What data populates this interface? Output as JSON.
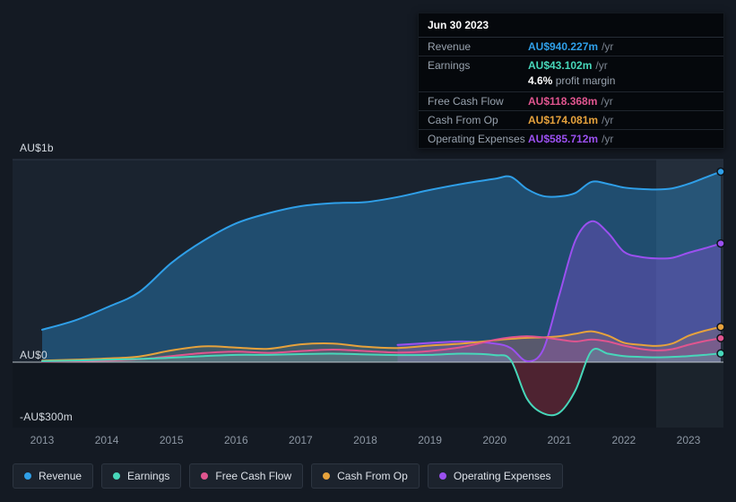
{
  "tooltip": {
    "date": "Jun 30 2023",
    "rows": [
      {
        "label": "Revenue",
        "value": "AU$940.227m",
        "suffix": "/yr",
        "color": "#2f9fe8"
      },
      {
        "label": "Earnings",
        "value": "AU$43.102m",
        "suffix": "/yr",
        "color": "#47d7ba",
        "sub_value": "4.6%",
        "sub_label": "profit margin"
      },
      {
        "label": "Free Cash Flow",
        "value": "AU$118.368m",
        "suffix": "/yr",
        "color": "#e0558f"
      },
      {
        "label": "Cash From Op",
        "value": "AU$174.081m",
        "suffix": "/yr",
        "color": "#e6a23c"
      },
      {
        "label": "Operating Expenses",
        "value": "AU$585.712m",
        "suffix": "/yr",
        "color": "#9b50f0"
      }
    ]
  },
  "axis": {
    "y_labels": [
      {
        "text": "AU$1b"
      },
      {
        "text": "AU$0"
      },
      {
        "text": "-AU$300m"
      }
    ],
    "x_ticks": [
      "2013",
      "2014",
      "2015",
      "2016",
      "2017",
      "2018",
      "2019",
      "2020",
      "2021",
      "2022",
      "2023"
    ]
  },
  "legend": [
    {
      "label": "Revenue",
      "color": "#2f9fe8"
    },
    {
      "label": "Earnings",
      "color": "#47d7ba"
    },
    {
      "label": "Free Cash Flow",
      "color": "#e0558f"
    },
    {
      "label": "Cash From Op",
      "color": "#e6a23c"
    },
    {
      "label": "Operating Expenses",
      "color": "#9b50f0"
    }
  ],
  "chart_data": {
    "type": "area",
    "unit": "AU$ millions per year",
    "x_range": [
      2013,
      2023.5
    ],
    "highlight_x": [
      2022.5,
      2023.55
    ],
    "y_ticks": [
      {
        "value": 1000,
        "label": "AU$1b"
      },
      {
        "value": 0,
        "label": "AU$0"
      },
      {
        "value": -300,
        "label": "-AU$300m"
      }
    ],
    "gridlines": [
      1000,
      0
    ],
    "ylim": [
      -330,
      1080
    ],
    "x": [
      2013,
      2013.5,
      2014,
      2014.5,
      2015,
      2015.5,
      2016,
      2016.5,
      2017,
      2017.5,
      2018,
      2018.5,
      2019,
      2019.5,
      2020,
      2020.25,
      2020.5,
      2020.75,
      2021,
      2021.25,
      2021.5,
      2021.75,
      2022,
      2022.25,
      2022.5,
      2022.75,
      2023,
      2023.25,
      2023.5
    ],
    "series": [
      {
        "name": "Revenue",
        "color": "#2f9fe8",
        "fill_opacity": 0.35,
        "values": [
          160,
          205,
          270,
          345,
          490,
          600,
          685,
          735,
          770,
          785,
          790,
          815,
          850,
          880,
          905,
          915,
          855,
          820,
          818,
          835,
          890,
          880,
          862,
          855,
          852,
          858,
          880,
          910,
          940.227
        ]
      },
      {
        "name": "Earnings",
        "color": "#47d7ba",
        "fill_opacity": 0.2,
        "negative_fill": "#8b3043",
        "values": [
          5,
          8,
          12,
          16,
          22,
          30,
          36,
          36,
          40,
          42,
          38,
          35,
          36,
          42,
          35,
          10,
          -180,
          -252,
          -250,
          -140,
          55,
          42,
          30,
          26,
          24,
          26,
          30,
          36,
          43.102
        ]
      },
      {
        "name": "Free Cash Flow",
        "color": "#e0558f",
        "fill_opacity": 0.16,
        "values": [
          2,
          5,
          8,
          14,
          30,
          45,
          52,
          46,
          55,
          62,
          55,
          48,
          55,
          75,
          110,
          122,
          128,
          122,
          112,
          102,
          112,
          102,
          82,
          66,
          58,
          64,
          86,
          104,
          118.368
        ]
      },
      {
        "name": "Cash From Op",
        "color": "#e6a23c",
        "fill_opacity": 0.16,
        "values": [
          8,
          12,
          18,
          28,
          58,
          78,
          72,
          66,
          88,
          92,
          76,
          70,
          82,
          92,
          108,
          115,
          120,
          122,
          128,
          140,
          152,
          132,
          96,
          86,
          80,
          92,
          130,
          155,
          174.081
        ]
      },
      {
        "name": "Operating Expenses",
        "color": "#9b50f0",
        "fill_opacity": 0.3,
        "values": [
          null,
          null,
          null,
          null,
          null,
          null,
          null,
          null,
          null,
          null,
          null,
          85,
          95,
          102,
          92,
          70,
          5,
          60,
          330,
          600,
          695,
          640,
          545,
          520,
          512,
          515,
          540,
          562,
          585.712
        ]
      }
    ]
  }
}
